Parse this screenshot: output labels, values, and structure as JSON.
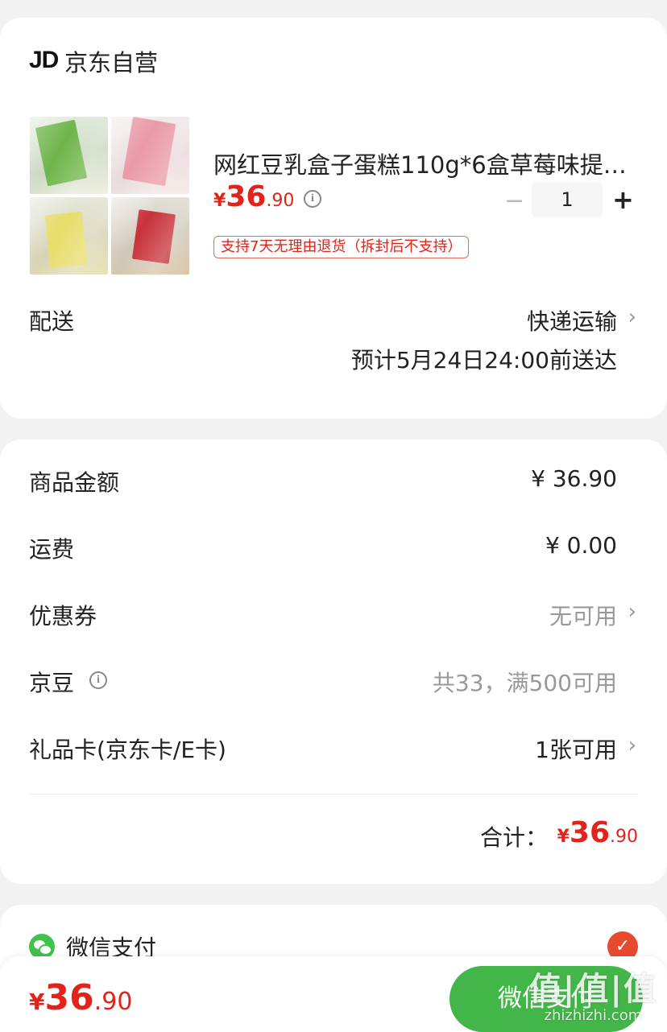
{
  "shop": {
    "logo": "JD",
    "name": "京东自营"
  },
  "product": {
    "title": "网红豆乳盒子蛋糕110g*6盒草莓味提…",
    "price": {
      "currency": "¥",
      "integer": "36",
      "decimal": ".90"
    },
    "quantity": "1",
    "minus_symbol": "−",
    "plus_symbol": "+",
    "info_symbol": "i",
    "return_tag": "支持7天无理由退货（拆封后不支持）"
  },
  "delivery": {
    "label": "配送",
    "method": "快递运输",
    "estimate": "预计5月24日24:00前送达"
  },
  "summary": {
    "rows": [
      {
        "label": "商品金额",
        "value": "¥ 36.90"
      },
      {
        "label": "运费",
        "value": "¥ 0.00"
      },
      {
        "label": "优惠券",
        "value": "无可用"
      },
      {
        "label": "京豆",
        "value": "共33，满500可用"
      },
      {
        "label": "礼品卡(京东卡/E卡)",
        "value": "1张可用"
      }
    ],
    "total_label": "合计：",
    "total": {
      "currency": "¥",
      "integer": "36",
      "decimal": ".90"
    }
  },
  "payment": {
    "method": "微信支付",
    "check_symbol": "✓"
  },
  "bottom": {
    "price": {
      "currency": "¥",
      "integer": "36",
      "decimal": ".90"
    },
    "pay_button": "微信支付"
  },
  "watermark": {
    "line1": "值|值|值",
    "line2": "zhizhizhi.com"
  },
  "chevron": "›",
  "colors": {
    "accent": "#e2231a",
    "wechat_green": "#43b649",
    "background": "#f2f2f2"
  }
}
